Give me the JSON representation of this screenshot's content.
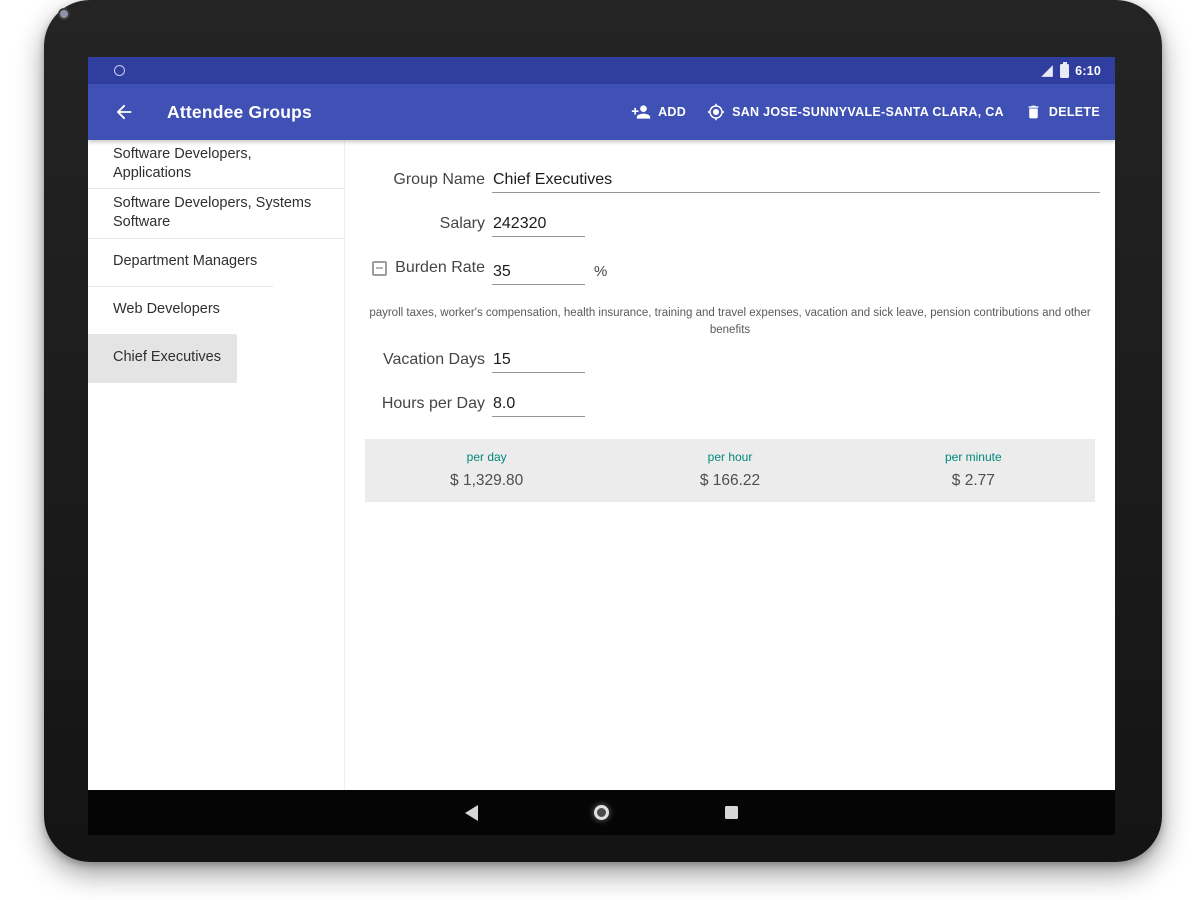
{
  "status_bar": {
    "time": "6:10",
    "icons": [
      "signal-icon",
      "battery-icon"
    ],
    "left_icon": "notification-circle-icon"
  },
  "app_bar": {
    "title": "Attendee Groups",
    "back_icon": "arrow-back-icon",
    "actions": {
      "add": {
        "label": "ADD",
        "icon": "person-add-icon"
      },
      "location": {
        "label": "SAN JOSE-SUNNYVALE-SANTA CLARA, CA",
        "icon": "my-location-icon"
      },
      "delete": {
        "label": "DELETE",
        "icon": "trash-icon"
      }
    }
  },
  "sidebar": {
    "items": [
      {
        "label": "Software Developers, Applications",
        "selected": false
      },
      {
        "label": "Software Developers, Systems Software",
        "selected": false
      },
      {
        "label": "Department Managers",
        "selected": false
      },
      {
        "label": "Web Developers",
        "selected": false
      },
      {
        "label": "Chief Executives",
        "selected": true
      }
    ]
  },
  "form": {
    "group_name": {
      "label": "Group Name",
      "value": "Chief Executives"
    },
    "salary": {
      "label": "Salary",
      "value": "242320"
    },
    "burden_rate": {
      "label": "Burden Rate",
      "value": "35",
      "unit": "%",
      "checkbox_state": "unchecked",
      "helper": "payroll taxes, worker's compensation, health insurance, training and travel expenses, vacation and sick leave, pension contributions and other benefits"
    },
    "vacation_days": {
      "label": "Vacation Days",
      "value": "15"
    },
    "hours_per_day": {
      "label": "Hours per Day",
      "value": "8.0"
    }
  },
  "summary": {
    "columns": [
      {
        "label": "per day",
        "value": "$ 1,329.80"
      },
      {
        "label": "per hour",
        "value": "$ 166.22"
      },
      {
        "label": "per minute",
        "value": "$ 2.77"
      }
    ]
  },
  "nav_bar": {
    "icons": [
      "back-icon",
      "home-icon",
      "recents-icon"
    ]
  },
  "colors": {
    "app_bar": "#3F51B5",
    "status_bar": "#303F9F",
    "accent_teal": "#00897B",
    "selected_item_bg": "#E4E4E4",
    "summary_bg": "#ECECEC"
  }
}
